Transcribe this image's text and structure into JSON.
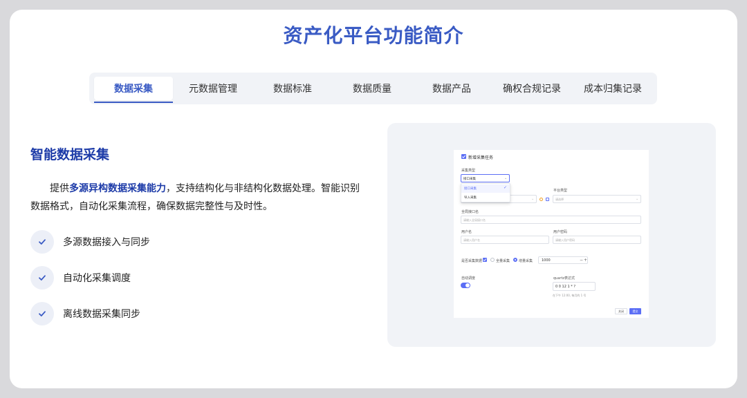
{
  "page": {
    "title": "资产化平台功能简介"
  },
  "tabs": [
    {
      "label": "数据采集",
      "active": true
    },
    {
      "label": "元数据管理",
      "active": false
    },
    {
      "label": "数据标准",
      "active": false
    },
    {
      "label": "数据质量",
      "active": false
    },
    {
      "label": "数据产品",
      "active": false
    },
    {
      "label": "确权合规记录",
      "active": false
    },
    {
      "label": "成本归集记录",
      "active": false
    }
  ],
  "section": {
    "heading": "智能数据采集",
    "desc_before": "提供",
    "desc_highlight": "多源异构数据采集能力",
    "desc_after": "，支持结构化与非结构化数据处理。智能识别数据格式，自动化采集流程，确保数据完整性与及时性。",
    "features": [
      {
        "label": "多源数据接入与同步",
        "icon": "check-icon"
      },
      {
        "label": "自动化采集调度",
        "icon": "check-icon"
      },
      {
        "label": "离线数据采集同步",
        "icon": "check-icon"
      }
    ]
  },
  "screenshot": {
    "dialog_title": "新增采集任务",
    "collect_type_label": "采集类型",
    "collect_type_value": "接口采集",
    "dropdown_options": [
      {
        "label": "接口采集",
        "selected": true
      },
      {
        "label": "导入采集",
        "selected": false
      }
    ],
    "platform_type_label": "平台类型",
    "platform_type_placeholder": "请选择",
    "full_interface_label": "全局接口名",
    "full_interface_placeholder": "请输入全局接口名",
    "user_label": "用户名",
    "user_placeholder": "请输入用户名",
    "password_label": "用户密码",
    "password_placeholder": "请输入用户密码",
    "need_data_label": "是否采集数据",
    "full_collect_label": "全量采集",
    "incremental_label": "增量采集",
    "stepper_value": "1000",
    "schedule_label": "自动调度",
    "quartz_label": "quartz表达式",
    "quartz_value": "0 0 12 1 * ?",
    "quartz_hint": "在下午 12:00, 每月的 1 号",
    "cancel_label": "关闭",
    "submit_label": "提交"
  },
  "colors": {
    "accent": "#3a5bc4",
    "heading": "#1d3ba8",
    "dialog_primary": "#5b6ef5"
  }
}
